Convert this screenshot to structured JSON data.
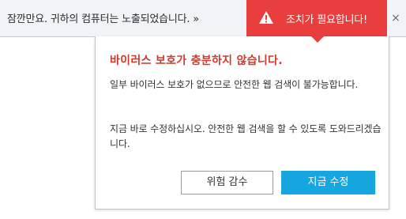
{
  "notification": {
    "message": "잠깐만요. 귀하의 컴퓨터는 노출되었습니다. »",
    "action_label": "조치가 필요합니다!",
    "action_icon": "warning-icon",
    "close_label": "×",
    "accent_color": "#e93e3e"
  },
  "panel": {
    "title": "바이러스 보호가 충분하지 않습니다.",
    "paragraph1": "일부 바이러스 보호가 없으므로 안전한 웹 검색이 불가능합니다.",
    "paragraph2": "지금 바로 수정하십시오. 안전한 웹 검색을 할 수 있도록 도와드리겠습니다.",
    "ignore_button": "위험 감수",
    "fix_button": "지금 수정",
    "title_color": "#cf3a2e",
    "fix_button_color": "#17a7e0"
  }
}
